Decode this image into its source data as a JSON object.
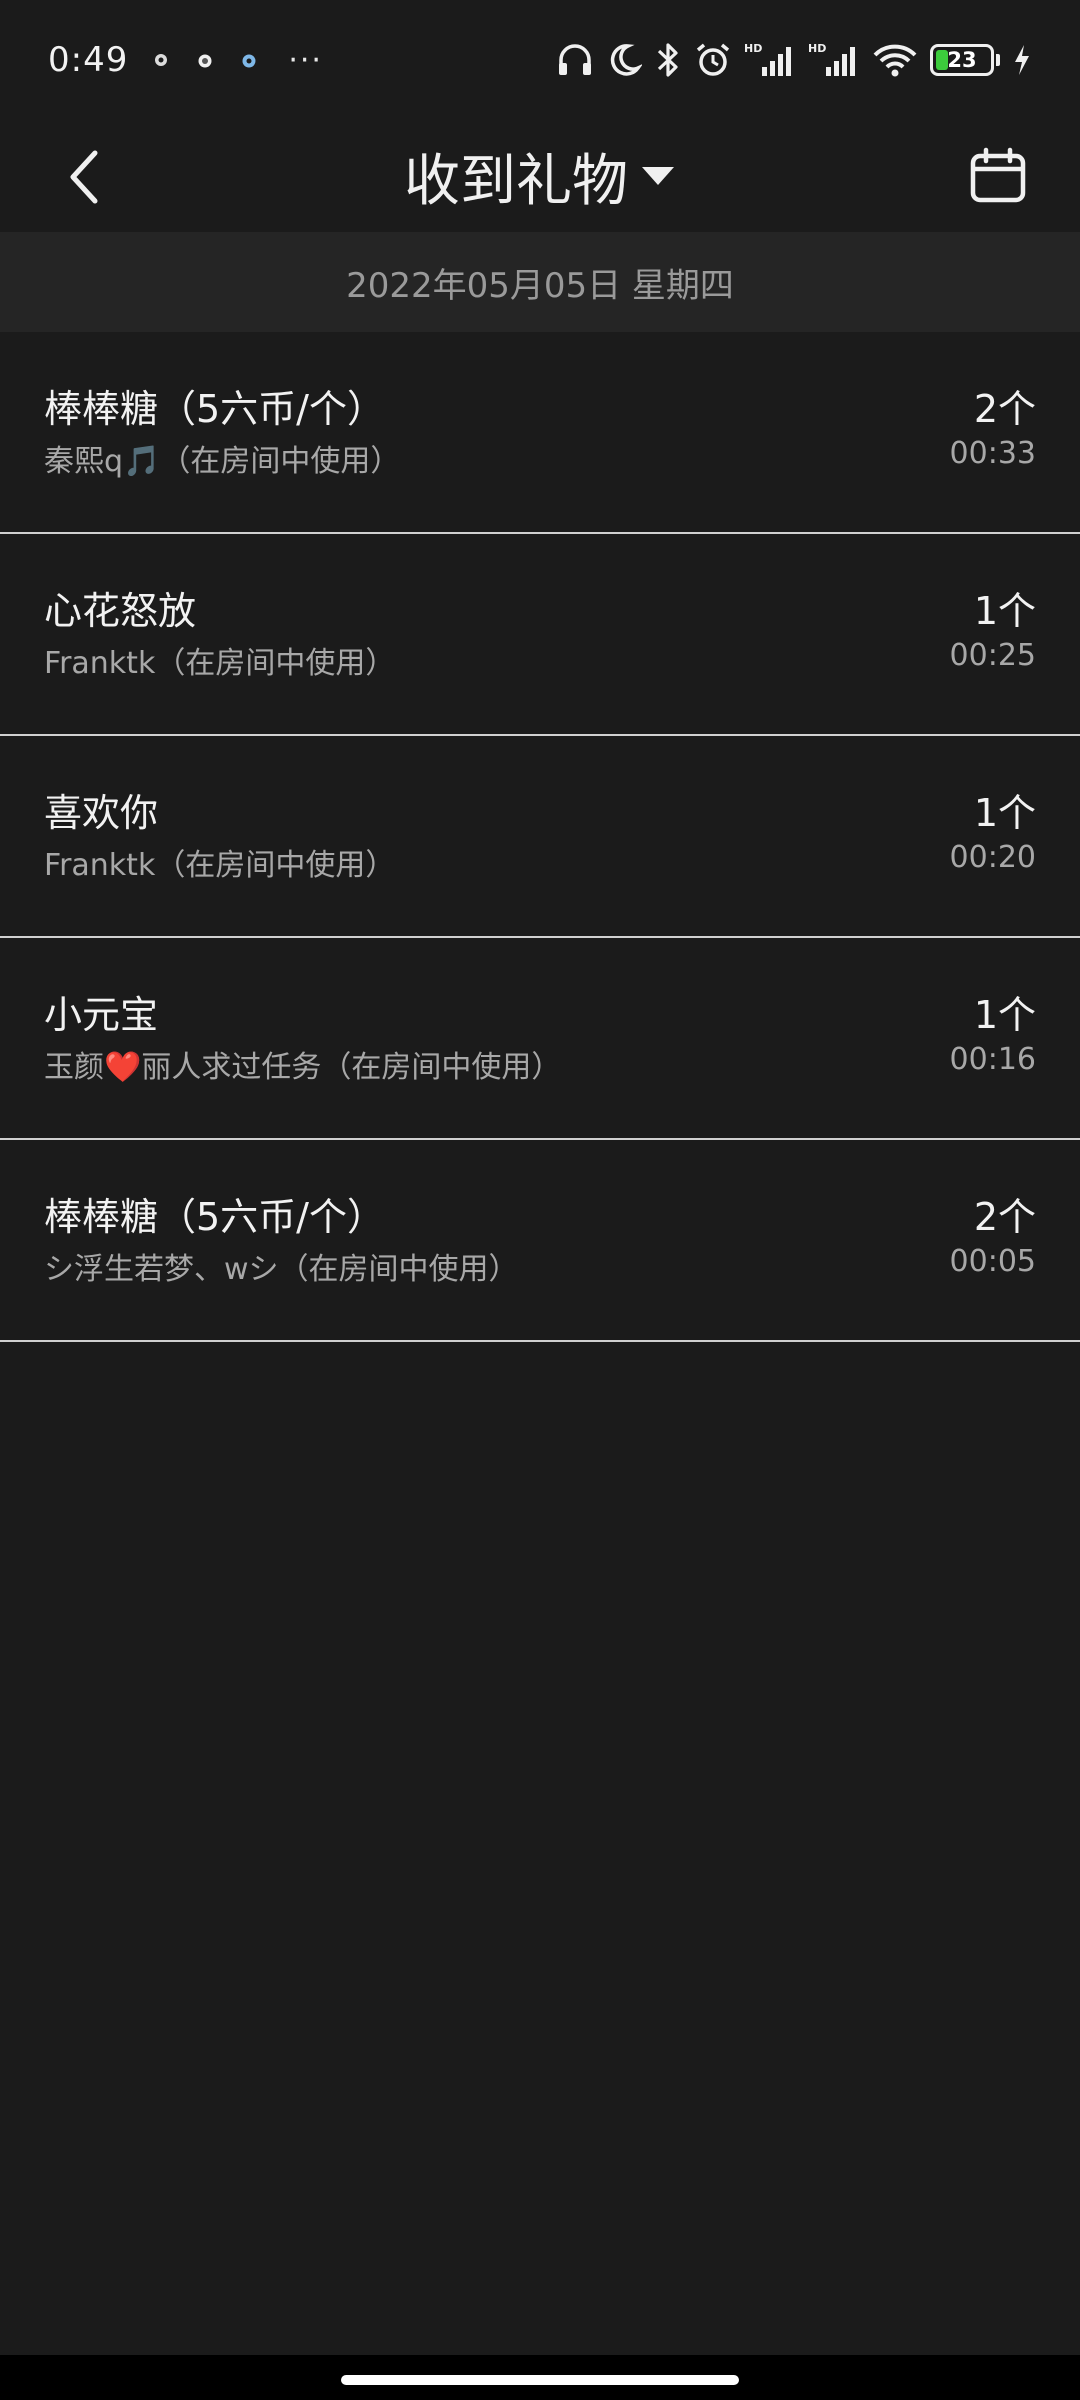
{
  "status_bar": {
    "time": "0:49",
    "more": "···",
    "battery": "23",
    "icons": [
      "notification-app-icon",
      "notification-app-icon",
      "notification-app-icon",
      "headphones-icon",
      "moon-icon",
      "bluetooth-icon",
      "alarm-icon",
      "signal-hd-icon",
      "signal-hd-icon",
      "wifi-icon",
      "battery-icon",
      "charging-icon"
    ]
  },
  "header": {
    "title": "收到礼物",
    "back_icon": "chevron-left-icon",
    "dropdown_icon": "caret-down-icon",
    "calendar_icon": "calendar-icon"
  },
  "date_bar": {
    "date": "2022年05月05日 星期四"
  },
  "gifts": [
    {
      "name": "棒棒糖（5六币/个）",
      "sender": "秦熙q🎵（在房间中使用）",
      "count": "2个",
      "time": "00:33"
    },
    {
      "name": "心花怒放",
      "sender": "Franktk（在房间中使用）",
      "count": "1个",
      "time": "00:25"
    },
    {
      "name": "喜欢你",
      "sender": "Franktk（在房间中使用）",
      "count": "1个",
      "time": "00:20"
    },
    {
      "name": "小元宝",
      "sender": "玉颜❤️丽人求过任务（在房间中使用）",
      "count": "1个",
      "time": "00:16"
    },
    {
      "name": "棒棒糖（5六币/个）",
      "sender": "シ浮生若梦、wシ（在房间中使用）",
      "count": "2个",
      "time": "00:05"
    }
  ],
  "colors": {
    "background": "#1b1b1b",
    "date_bar": "#252525",
    "divider": "#d0d0d0",
    "secondary_text": "#a8a8a8",
    "battery_fill": "#3ccc3c"
  },
  "battery_level": 0.23
}
